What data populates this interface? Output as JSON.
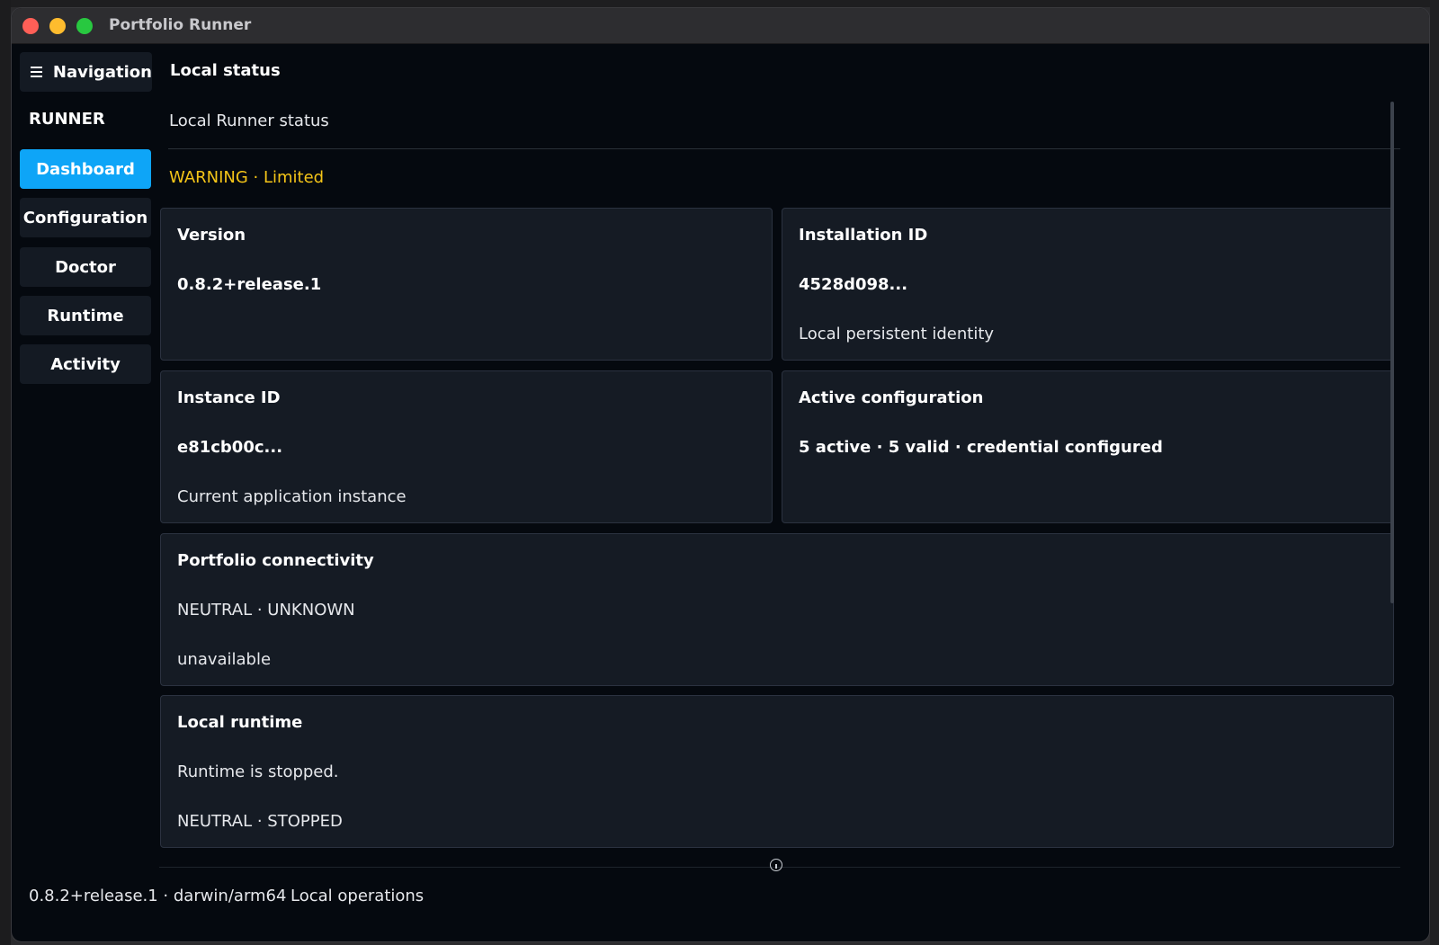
{
  "window": {
    "title": "Portfolio Runner"
  },
  "nav_toggle": {
    "label": "Navigation"
  },
  "section_title": "Local status",
  "sidebar": {
    "group_label": "RUNNER",
    "items": [
      {
        "label": "Dashboard",
        "active": true
      },
      {
        "label": "Configuration",
        "active": false
      },
      {
        "label": "Doctor",
        "active": false
      },
      {
        "label": "Runtime",
        "active": false
      },
      {
        "label": "Activity",
        "active": false
      }
    ]
  },
  "content": {
    "header": "Local Runner status",
    "warning": "WARNING · Limited",
    "cards": {
      "version": {
        "title": "Version",
        "value": "0.8.2+release.1"
      },
      "installation": {
        "title": "Installation ID",
        "value": "4528d098...",
        "note": "Local persistent identity"
      },
      "instance": {
        "title": "Instance ID",
        "value": "e81cb00c...",
        "note": "Current application instance"
      },
      "active_config": {
        "title": "Active configuration",
        "value": "5 active · 5 valid · credential configured"
      },
      "connectivity": {
        "title": "Portfolio connectivity",
        "line1": "NEUTRAL · UNKNOWN",
        "line2": "unavailable"
      },
      "runtime": {
        "title": "Local runtime",
        "line1": "Runtime is stopped.",
        "line2": "NEUTRAL · STOPPED"
      }
    }
  },
  "footer": {
    "version_platform": "0.8.2+release.1 · darwin/arm64",
    "mode": "Local operations"
  },
  "colors": {
    "accent": "#0ea5f7",
    "warning": "#f5c518",
    "background": "#05090f",
    "card": "#151b24"
  }
}
